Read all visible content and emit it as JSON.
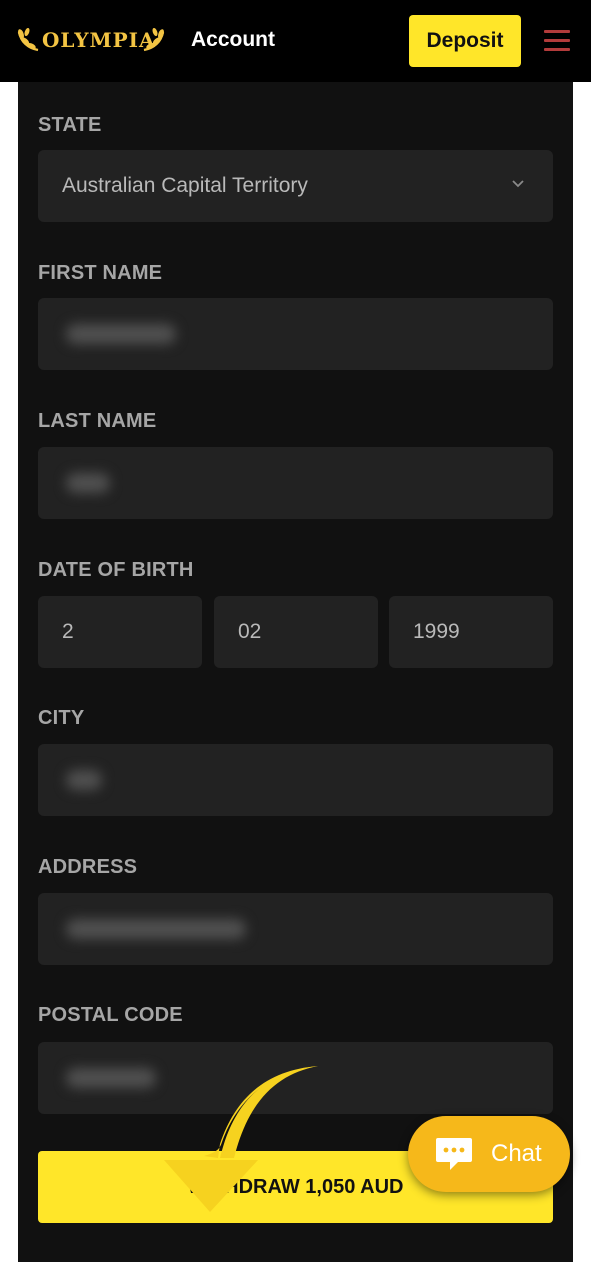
{
  "header": {
    "brand": "OLYMPIA",
    "title": "Account",
    "deposit_label": "Deposit",
    "menu_icon": "hamburger-menu-icon"
  },
  "form": {
    "state": {
      "label": "STATE",
      "value": "Australian Capital Territory"
    },
    "first_name": {
      "label": "FIRST NAME"
    },
    "last_name": {
      "label": "LAST NAME"
    },
    "dob": {
      "label": "DATE OF BIRTH",
      "day": "2",
      "month": "02",
      "year": "1999"
    },
    "city": {
      "label": "CITY"
    },
    "address": {
      "label": "ADDRESS"
    },
    "postal_code": {
      "label": "POSTAL CODE"
    },
    "withdraw_label": "WITHDRAW 1,050 AUD"
  },
  "chat": {
    "label": "Chat",
    "icon": "chat-bubble-icon"
  },
  "colors": {
    "accent_yellow": "#ffe629",
    "chat_orange": "#f6b81a",
    "panel_bg": "#111111",
    "field_bg": "#222222",
    "label_gray": "#a6a6a6",
    "brand_gold": "#f3c443"
  }
}
